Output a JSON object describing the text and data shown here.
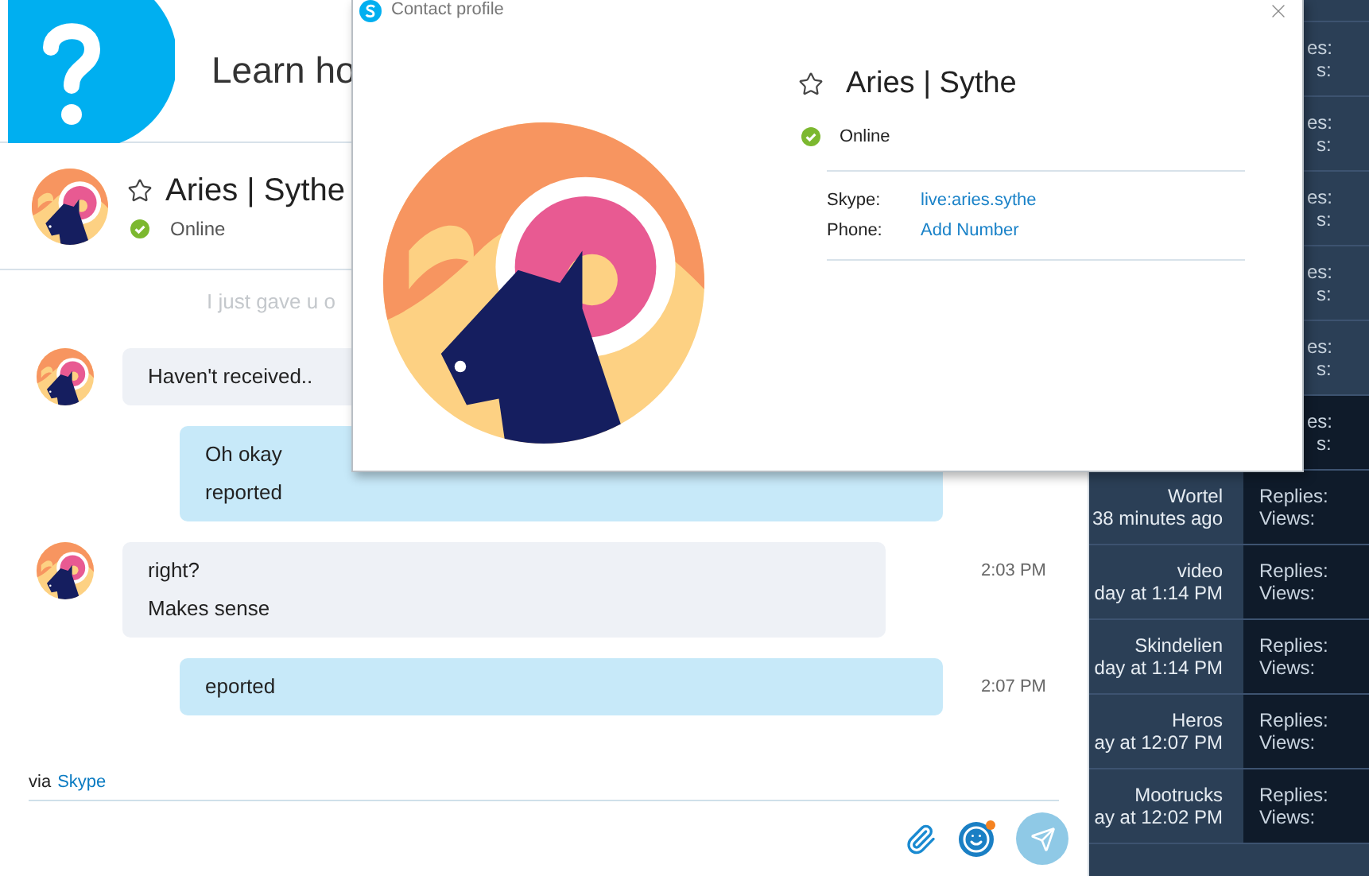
{
  "chat": {
    "banner": {
      "text": "Learn ho"
    },
    "contact": {
      "name": "Aries | Sythe",
      "status": "Online",
      "favorite": false
    },
    "faded_message": "I just gave u o",
    "messages": [
      {
        "kind": "incoming",
        "lines": [
          "Haven't received.."
        ]
      },
      {
        "kind": "outgoing",
        "lines": [
          "Oh okay",
          "reported"
        ]
      },
      {
        "kind": "incoming",
        "lines": [
          "right?",
          "Makes sense"
        ],
        "time": "2:03 PM"
      },
      {
        "kind": "outgoing",
        "lines": [
          "eported"
        ],
        "time": "2:07 PM"
      }
    ],
    "via": {
      "prefix": "via",
      "link": "Skype"
    }
  },
  "contact_profile": {
    "title": "Contact profile",
    "name": "Aries | Sythe",
    "status": "Online",
    "favorite": false,
    "fields": [
      {
        "label": "Skype:",
        "value": "live:aries.sythe"
      },
      {
        "label": "Phone:",
        "value": "Add Number"
      }
    ]
  },
  "forum": {
    "rows": [
      {
        "kind": "covered",
        "replies": "es:",
        "views": "s:",
        "selected": false
      },
      {
        "kind": "covered",
        "replies": "es:",
        "views": "s:",
        "selected": false
      },
      {
        "kind": "covered",
        "replies": "es:",
        "views": "s:",
        "selected": false
      },
      {
        "kind": "covered",
        "replies": "es:",
        "views": "s:",
        "selected": false
      },
      {
        "kind": "covered",
        "replies": "es:",
        "views": "s:",
        "selected": false
      },
      {
        "kind": "covered",
        "replies": "es:",
        "views": "s:",
        "selected": true
      },
      {
        "kind": "thread",
        "name": "Wortel",
        "time": "38 minutes ago",
        "replies": "Replies:",
        "views": "Views:",
        "selected": false
      },
      {
        "kind": "thread",
        "name": "video",
        "time": "day at 1:14 PM",
        "replies": "Replies:",
        "views": "Views:",
        "selected": false
      },
      {
        "kind": "thread",
        "name": "Skindelien",
        "time": "day at 1:14 PM",
        "replies": "Replies:",
        "views": "Views:",
        "selected": false
      },
      {
        "kind": "thread",
        "name": "Heros",
        "time": "ay at 12:07 PM",
        "replies": "Replies:",
        "views": "Views:",
        "selected": false
      },
      {
        "kind": "thread",
        "name": "Mootrucks",
        "time": "ay at 12:02 PM",
        "replies": "Replies:",
        "views": "Views:",
        "selected": false
      }
    ]
  }
}
